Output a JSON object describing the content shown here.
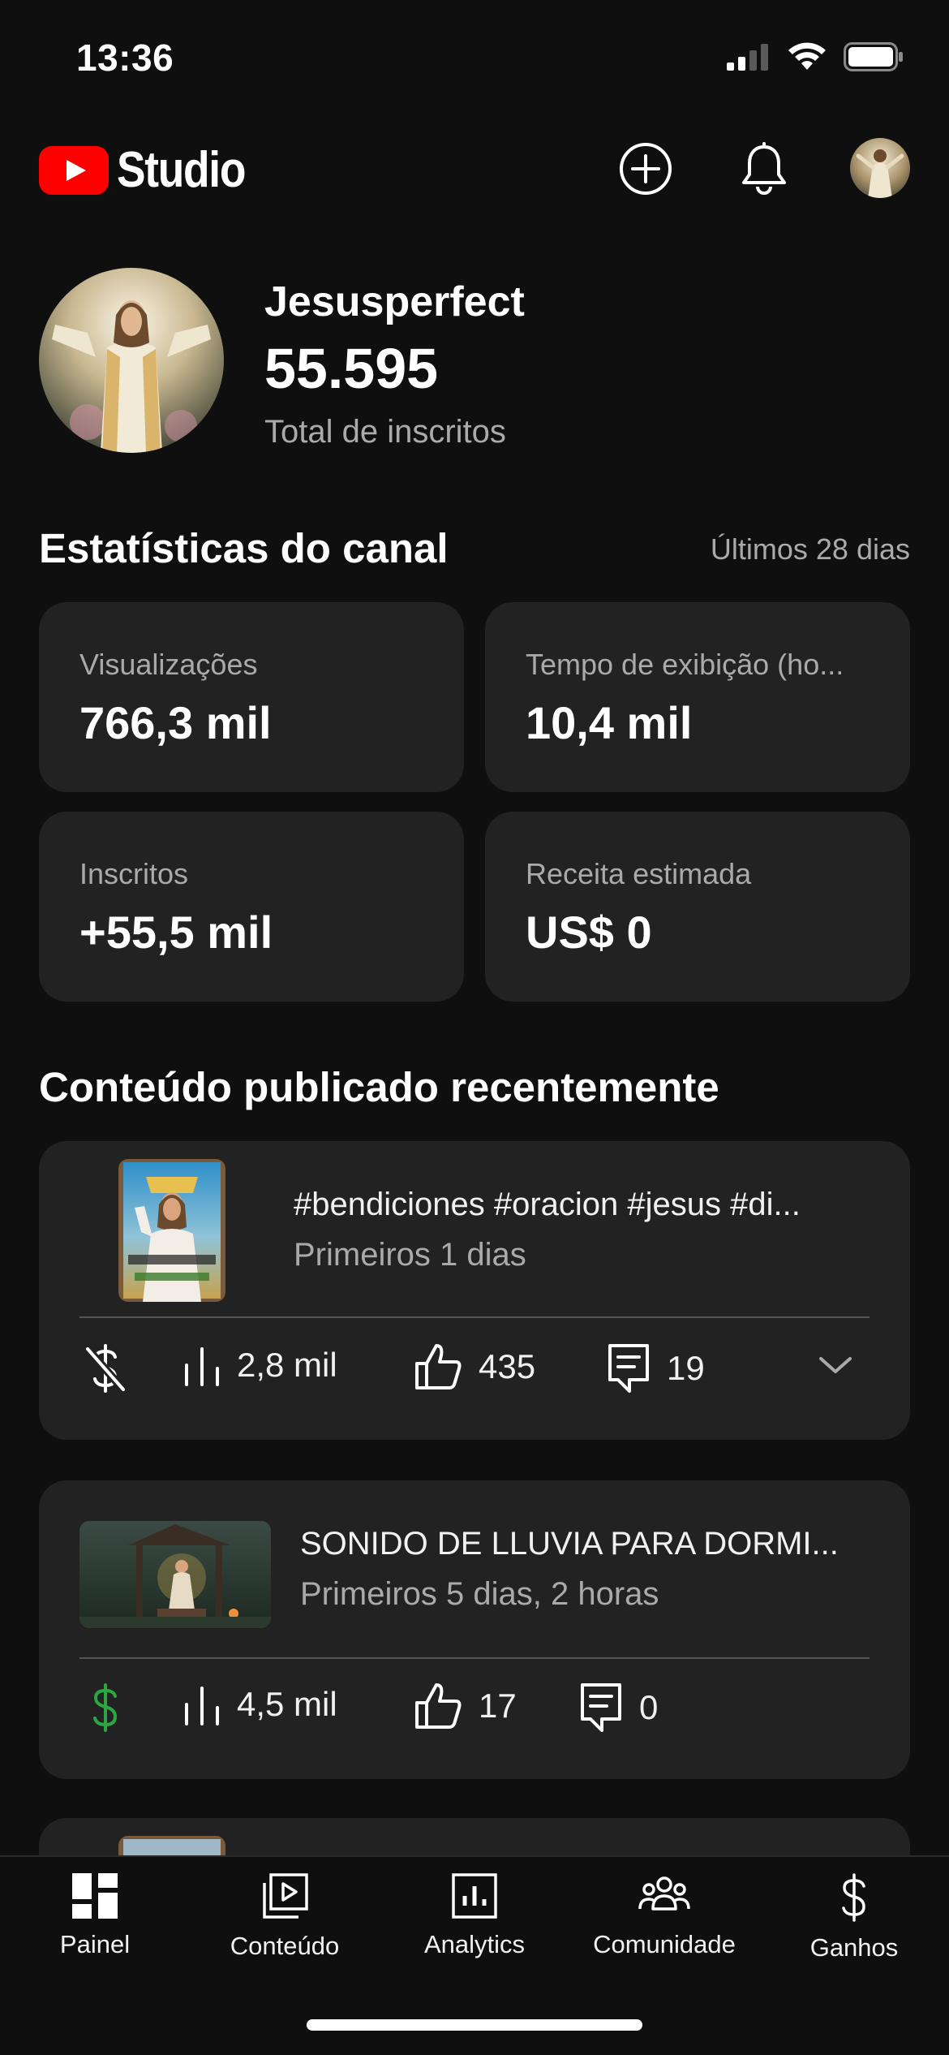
{
  "status_bar": {
    "time": "13:36"
  },
  "header": {
    "app_name": "Studio"
  },
  "channel": {
    "name": "Jesusperfect",
    "subscriber_count": "55.595",
    "subscriber_label": "Total de inscritos"
  },
  "stats": {
    "title": "Estatísticas do canal",
    "period": "Últimos 28 dias",
    "cards": [
      {
        "label": "Visualizações",
        "value": "766,3 mil"
      },
      {
        "label": "Tempo de exibição (ho...",
        "value": "10,4 mil"
      },
      {
        "label": "Inscritos",
        "value": "+55,5 mil"
      },
      {
        "label": "Receita estimada",
        "value": "US$ 0"
      }
    ]
  },
  "recent": {
    "title": "Conteúdo publicado recentemente",
    "items": [
      {
        "title": "#bendiciones #oracion #jesus #di...",
        "subtitle": "Primeiros 1 dias",
        "views": "2,8 mil",
        "likes": "435",
        "comments": "19",
        "monetization": "off",
        "colors": {
          "monetization_icon": "#ffffff"
        }
      },
      {
        "title": "SONIDO DE LLUVIA PARA DORMI...",
        "subtitle": "Primeiros 5 dias, 2 horas",
        "views": "4,5 mil",
        "likes": "17",
        "comments": "0",
        "monetization": "on",
        "colors": {
          "monetization_icon": "#2ba640"
        }
      }
    ]
  },
  "nav": {
    "items": [
      {
        "label": "Painel",
        "icon": "dashboard-icon"
      },
      {
        "label": "Conteúdo",
        "icon": "content-icon"
      },
      {
        "label": "Analytics",
        "icon": "analytics-icon"
      },
      {
        "label": "Comunidade",
        "icon": "community-icon"
      },
      {
        "label": "Ganhos",
        "icon": "earnings-icon"
      }
    ]
  },
  "colors": {
    "background": "#0f0f0f",
    "card": "#222222",
    "youtube_red": "#ff0000",
    "secondary_text": "#aaaaaa",
    "monetized_green": "#2ba640"
  }
}
